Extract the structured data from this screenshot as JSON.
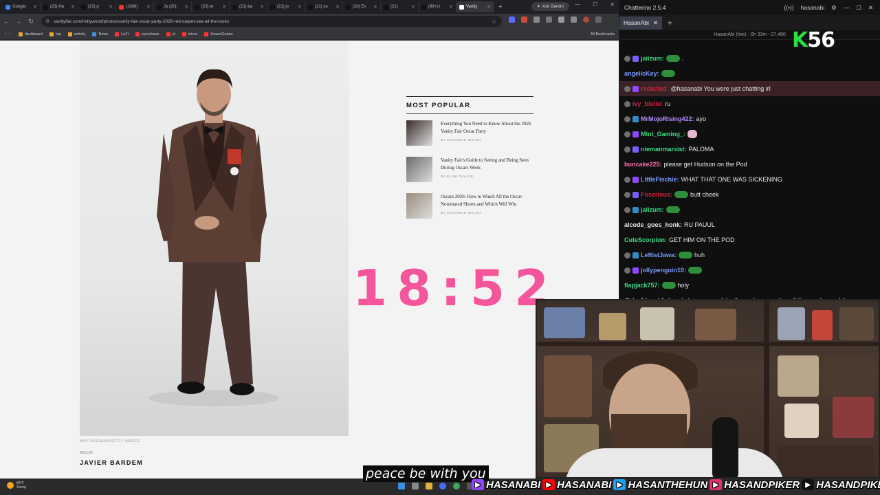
{
  "browser": {
    "tabs": [
      {
        "label": "Google",
        "color": "#4285f4"
      },
      {
        "label": "(23) Ha",
        "color": "#111111"
      },
      {
        "label": "(23) p",
        "color": "#111111"
      },
      {
        "label": "(1808)",
        "color": "#ff2d2d"
      },
      {
        "label": "Jo (20)",
        "color": "#111111"
      },
      {
        "label": "(23) ei",
        "color": "#111111"
      },
      {
        "label": "(21) ba",
        "color": "#111111"
      },
      {
        "label": "(21) jo",
        "color": "#111111"
      },
      {
        "label": "(21) co",
        "color": "#111111"
      },
      {
        "label": "(20) Ev",
        "color": "#111111"
      },
      {
        "label": "(21)",
        "color": "#111111"
      },
      {
        "label": "(99+) l",
        "color": "#111111"
      },
      {
        "label": "Vanity",
        "color": "#ffffff",
        "active": true
      }
    ],
    "ask_button": "Ask Gemini",
    "url": "vanityfair.com/hollywood/photos/vanity-fair-oscar-party-2026-red-carpet-see-all-the-looks",
    "bookmarks": [
      {
        "label": "dashboard",
        "color": "#e8a33d"
      },
      {
        "label": "top",
        "color": "#e8a33d"
      },
      {
        "label": "activity",
        "color": "#e8a33d"
      },
      {
        "label": "News",
        "color": "#4a90e2"
      },
      {
        "label": "LoFi",
        "color": "#ff3333"
      },
      {
        "label": "sync/wave",
        "color": "#ff3333"
      },
      {
        "label": "yt",
        "color": "#ff3333"
      },
      {
        "label": "intros",
        "color": "#ff3333"
      },
      {
        "label": "HasanGamer",
        "color": "#ff3333"
      }
    ],
    "bookmarks_right": "All Bookmarks"
  },
  "article": {
    "photo_credit": "AMY SUSSMAN/GETTY IMAGES",
    "counter": "AB/182",
    "subject": "JAVIER BARDEM",
    "popular_title": "MOST POPULAR",
    "popular": [
      {
        "headline": "Everything You Need to Know About the 2026 Vanity Fair Oscar Party",
        "byline": "BY SAVANNAH WALSH",
        "thumb": "#3a2b2b"
      },
      {
        "headline": "Vanity Fair's Guide to Seeing and Being Seen During Oscars Week",
        "byline": "BY ELISE TAYLOR",
        "thumb": "#6b6b6b"
      },
      {
        "headline": "Oscars 2026: How to Watch All the Oscar-Nominated Shorts and Which Will Win",
        "byline": "BY SAVANNAH WALSH",
        "thumb": "#9a8c7a"
      }
    ]
  },
  "overlay": {
    "timer": "18:52",
    "subtitle": "peace be with you",
    "kill_count": "56",
    "kill_prefix": "K"
  },
  "chat": {
    "app_title": "Chatterino 2.5.4",
    "account": "hasanabi",
    "tab": "HasanAbi",
    "status": "HasanAbi (live) - 0h 33m - 27,480",
    "messages": [
      {
        "user": "jaiizum:",
        "color": "#3ddc84",
        "text": "",
        "emote": "green",
        "badges": 2,
        "suffix": "."
      },
      {
        "user": "angelicKey:",
        "color": "#7b9cff",
        "text": "",
        "emote": "green",
        "badges": 0
      },
      {
        "user": "redacted:",
        "color": "#d0243e",
        "text": "@hasanabi You were just chatting irl",
        "badges": 2,
        "highlight": true
      },
      {
        "user": "ivy_biolio:",
        "color": "#d0243e",
        "text": "ru",
        "badges": 1
      },
      {
        "user": "MrMojoRising422:",
        "color": "#b48cff",
        "text": "ayo",
        "badges": 2
      },
      {
        "user": "Mint_Gaming_:",
        "color": "#3ddc84",
        "text": "",
        "emote": "pink",
        "badges": 2
      },
      {
        "user": "niemanmarxist:",
        "color": "#3ddc84",
        "text": "PALOMA",
        "badges": 2
      },
      {
        "user": "buncake225:",
        "color": "#ff6fa8",
        "text": "please get Hudson on the Pod",
        "badges": 0
      },
      {
        "user": "LittleFischie:",
        "color": "#7b9cff",
        "text": "WHAT THAT ONE WAS SICKENING",
        "badges": 2
      },
      {
        "user": "Foserious:",
        "color": "#d0243e",
        "text": "butt cheek",
        "emote": "green",
        "badges": 2
      },
      {
        "user": "jaiizum:",
        "color": "#3ddc84",
        "text": "",
        "emote": "green",
        "badges": 2
      },
      {
        "user": "alcode_goes_honk:",
        "color": "#e6e6e6",
        "text": "RU PAUUL",
        "badges": 0
      },
      {
        "user": "CuteScorpion:",
        "color": "#3ddc84",
        "text": "GET HIM ON THE POD",
        "badges": 0
      },
      {
        "user": "LeftistJawa:",
        "color": "#7b9cff",
        "text": "huh",
        "emote": "green",
        "badges": 2
      },
      {
        "user": "jollypenguin10:",
        "color": "#7b9cff",
        "text": "",
        "emote": "green",
        "badges": 2
      },
      {
        "user": "flapjack757:",
        "color": "#3ddc84",
        "text": "holy",
        "emote": "green",
        "badges": 0
      },
      {
        "user": "techinvoid:",
        "color": "#e6e6e6",
        "text": "there's too many celebs these days e gotta cull the numbers a bit",
        "badges": 1
      }
    ]
  },
  "socials": [
    {
      "icon": "twitch-icon",
      "text": "HASANABI",
      "color": "#9146ff"
    },
    {
      "icon": "youtube-icon",
      "text": "HASANABI",
      "color": "#ff0000"
    },
    {
      "icon": "twitter-icon",
      "text": "HASANTHEHUN",
      "color": "#1da1f2"
    },
    {
      "icon": "instagram-icon",
      "text": "HASANDPIKER",
      "color": "#e1306c"
    },
    {
      "icon": "tiktok-icon",
      "text": "HASANDPIKER",
      "color": "#111111"
    }
  ],
  "taskbar": {
    "temp": "60°F",
    "weather": "Sunny"
  }
}
